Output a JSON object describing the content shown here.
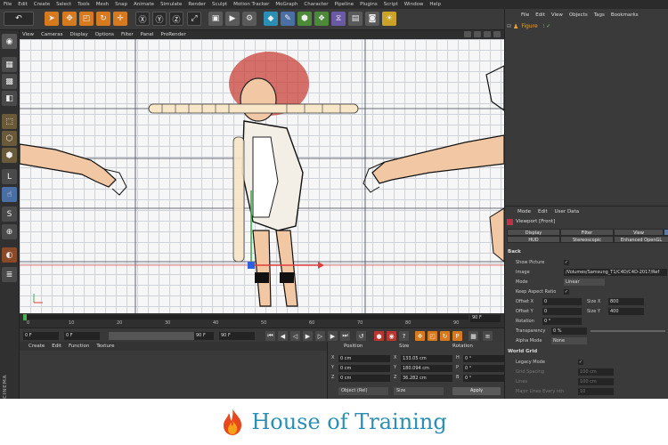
{
  "menubar": [
    "File",
    "Edit",
    "Create",
    "Select",
    "Tools",
    "Mesh",
    "Snap",
    "Animate",
    "Simulate",
    "Render",
    "Sculpt",
    "Motion Tracker",
    "MoGraph",
    "Character",
    "Pipeline",
    "Plugins",
    "Script",
    "Window",
    "Help"
  ],
  "viewport": {
    "menu": [
      "View",
      "Cameras",
      "Display",
      "Options",
      "Filter",
      "Panel",
      "ProRender"
    ]
  },
  "timeline": {
    "ticks": [
      "0",
      "10",
      "20",
      "30",
      "40",
      "50",
      "60",
      "70",
      "80",
      "90"
    ],
    "end_field": "90 F"
  },
  "transport": {
    "current_frame": "0 F",
    "start_frame": "0 F",
    "end_frame_a": "90 F",
    "end_frame_b": "90 F"
  },
  "material_manager": {
    "menu": [
      "Create",
      "Edit",
      "Function",
      "Texture"
    ]
  },
  "coordinates": {
    "headers": {
      "position": "Position",
      "size": "Size",
      "rotation": "Rotation"
    },
    "rows": [
      {
        "axis": "X",
        "pos": "0 cm",
        "size_axis": "X",
        "size": "133.05 cm",
        "rot_axis": "H",
        "rot": "0 °"
      },
      {
        "axis": "Y",
        "pos": "0 cm",
        "size_axis": "Y",
        "size": "180.094 cm",
        "rot_axis": "P",
        "rot": "0 °"
      },
      {
        "axis": "Z",
        "pos": "0 cm",
        "size_axis": "Z",
        "size": "36.282 cm",
        "rot_axis": "B",
        "rot": "0 °"
      }
    ],
    "mode_dropdown": "Object (Rel)",
    "size_dropdown": "Size",
    "apply_label": "Apply"
  },
  "object_manager": {
    "menu": [
      "File",
      "Edit",
      "View",
      "Objects",
      "Tags",
      "Bookmarks"
    ],
    "objects": [
      {
        "name": "Figure"
      }
    ]
  },
  "attribute_manager": {
    "menu": [
      "Mode",
      "Edit",
      "User Data"
    ],
    "title": "Viewport [Front]",
    "tabs_row1": [
      "Display",
      "Filter",
      "View"
    ],
    "tabs_row2": [
      "HUD",
      "Stereoscopic",
      "Enhanced OpenGL"
    ],
    "back_section": "Back",
    "fields": {
      "show_picture": "Show Picture",
      "image_label": "Image",
      "image_path": "/Volumes/Samsung_T1/C4D/C4D-2017/Ref",
      "mode_label": "Mode",
      "mode_value": "Linear",
      "keep_aspect": "Keep Aspect Ratio",
      "offset_x_label": "Offset X",
      "offset_x": "0",
      "size_x_label": "Size X",
      "size_x": "800",
      "offset_y_label": "Offset Y",
      "offset_y": "0",
      "size_y_label": "Size Y",
      "size_y": "400",
      "rotation_label": "Rotation",
      "rotation": "0 °",
      "transparency_label": "Transparency",
      "transparency": "0 %",
      "alpha_label": "Alpha Mode",
      "alpha_value": "None"
    },
    "world_grid_section": "World Grid",
    "grid": {
      "legacy_mode": "Legacy Mode",
      "grid_spacing_label": "Grid Spacing",
      "grid_spacing": "100 cm",
      "lines_label": "Lines",
      "lines": "100 cm",
      "major_label": "Major Lines Every nth",
      "major": "10"
    }
  },
  "branding": {
    "text": "House of Training"
  },
  "colors": {
    "accent_orange": "#d77a1e",
    "brand_blue": "#2b8fb5",
    "flame": "#e8481c"
  }
}
